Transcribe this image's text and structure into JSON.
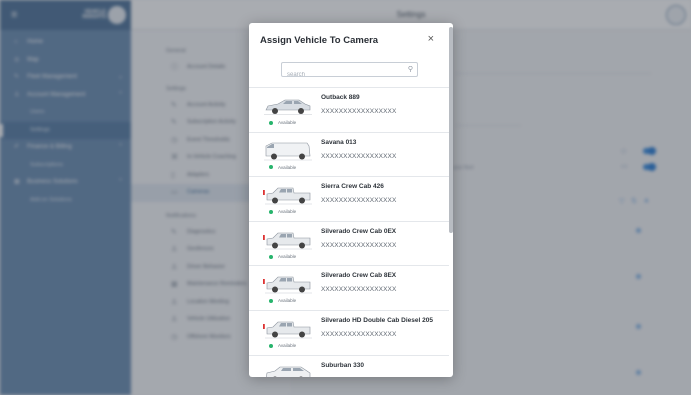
{
  "app": {
    "topbar_title": "Settings",
    "logo_text": "VEHICLE INSIGHTS"
  },
  "sidebar": {
    "items": [
      {
        "label": "Home",
        "icon": "home-icon"
      },
      {
        "label": "Map",
        "icon": "map-icon"
      },
      {
        "label": "Fleet Management",
        "icon": "wrench-icon"
      },
      {
        "label": "Account Management",
        "icon": "person-icon"
      },
      {
        "label": "Users",
        "icon": ""
      },
      {
        "label": "Settings",
        "icon": ""
      },
      {
        "label": "Finance & Billing",
        "icon": "tag-icon"
      },
      {
        "label": "Subscriptions",
        "icon": ""
      },
      {
        "label": "Business Solutions",
        "icon": "grid-icon"
      },
      {
        "label": "Add-on Solutions",
        "icon": ""
      }
    ]
  },
  "settings_nav": {
    "general_label": "General",
    "general_items": [
      "Account Details"
    ],
    "settings_label": "Settings",
    "settings_items": [
      "Account Activity",
      "Subscription Activity",
      "Event Thresholds",
      "In-Vehicle Coaching",
      "Adapters",
      "Cameras"
    ],
    "notifications_label": "Notifications",
    "notification_items": [
      "Diagnostics",
      "Geofences",
      "Driver Behavior",
      "Maintenance Reminders",
      "Location Meeting",
      "Vehicle Utilization",
      "Offshore Monitors"
    ]
  },
  "content": {
    "fleet_text": "your fleet",
    "status_text": "Available"
  },
  "modal": {
    "title": "Assign Vehicle To Camera",
    "close": "×",
    "search_placeholder": "search",
    "vehicles": [
      {
        "name": "Outback 889",
        "vin": "XXXXXXXXXXXXXXXXX",
        "status": "Available",
        "type": "wagon"
      },
      {
        "name": "Savana 013",
        "vin": "XXXXXXXXXXXXXXXXX",
        "status": "Available",
        "type": "van"
      },
      {
        "name": "Sierra Crew Cab 426",
        "vin": "XXXXXXXXXXXXXXXXX",
        "status": "Available",
        "type": "truck"
      },
      {
        "name": "Silverado Crew Cab 0EX",
        "vin": "XXXXXXXXXXXXXXXXX",
        "status": "Available",
        "type": "truck"
      },
      {
        "name": "Silverado Crew Cab 8EX",
        "vin": "XXXXXXXXXXXXXXXXX",
        "status": "Available",
        "type": "truck"
      },
      {
        "name": "Silverado HD Double Cab Diesel 205",
        "vin": "XXXXXXXXXXXXXXXXX",
        "status": "Available",
        "type": "truck"
      },
      {
        "name": "Suburban 330",
        "vin": "",
        "status": "",
        "type": "suv"
      }
    ]
  },
  "colors": {
    "sidebar": "#6d8fb3",
    "accent": "#2e7fd6",
    "available": "#27b46c"
  }
}
